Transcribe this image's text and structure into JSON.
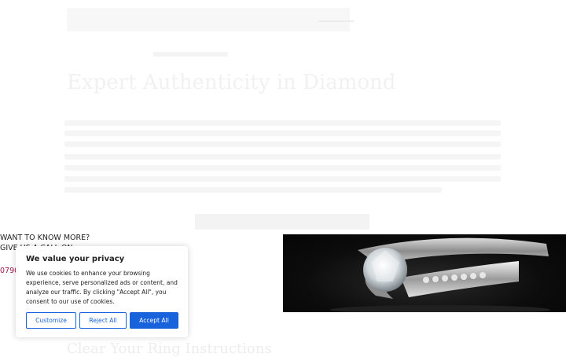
{
  "hero": {
    "heading": "Expert Authenticity in Diamond"
  },
  "contact": {
    "want_more": "WANT TO KNOW MORE?",
    "give_call": "GIVE US A CALL ON",
    "phone": "0790"
  },
  "cookie": {
    "title": "We value your privacy",
    "body": "We use cookies to enhance your browsing experience, serve personalized ads or content, and analyze our traffic. By clicking \"Accept All\", you consent to our use of cookies.",
    "customize_label": "Customize",
    "reject_label": "Reject All",
    "accept_label": "Accept All"
  },
  "section": {
    "heading": "Clear Your Ring Instructions"
  },
  "colors": {
    "accent": "#1863dc",
    "phone": "#a01848"
  }
}
